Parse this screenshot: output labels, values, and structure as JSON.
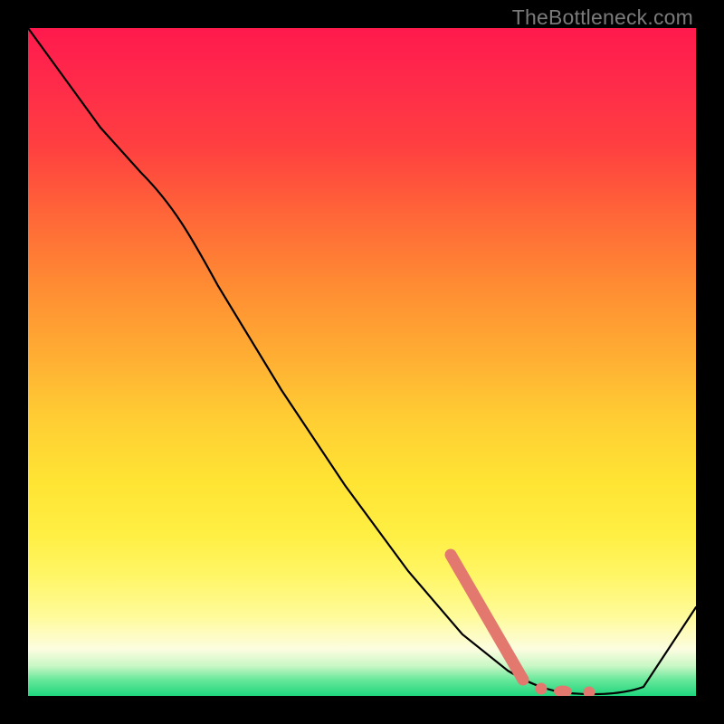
{
  "watermark": "TheBottleneck.com",
  "chart_data": {
    "type": "line",
    "title": "",
    "xlabel": "",
    "ylabel": "",
    "xlim": [
      0,
      100
    ],
    "ylim": [
      0,
      100
    ],
    "grid": false,
    "series": [
      {
        "name": "bottleneck-curve",
        "color": "#000000",
        "x": [
          0,
          5,
          10,
          15,
          20,
          25,
          30,
          35,
          40,
          45,
          50,
          55,
          60,
          65,
          70,
          75,
          78,
          80,
          82,
          85,
          90,
          100
        ],
        "y": [
          100,
          94,
          88,
          82,
          76,
          68,
          58,
          48,
          39,
          31,
          24,
          18,
          13,
          9,
          5,
          2,
          1,
          0.5,
          0.3,
          0.2,
          0.7,
          14
        ]
      }
    ],
    "highlight": {
      "name": "highlight-marker",
      "type": "line",
      "color": "#e2786e",
      "x": [
        60,
        75
      ],
      "y": [
        30,
        0.5
      ]
    },
    "highlight_dots": {
      "name": "highlight-dots",
      "type": "scatter",
      "color": "#e2786e",
      "x": [
        77.5,
        80,
        83.5
      ],
      "y": [
        0.4,
        0.3,
        0.3
      ]
    }
  }
}
